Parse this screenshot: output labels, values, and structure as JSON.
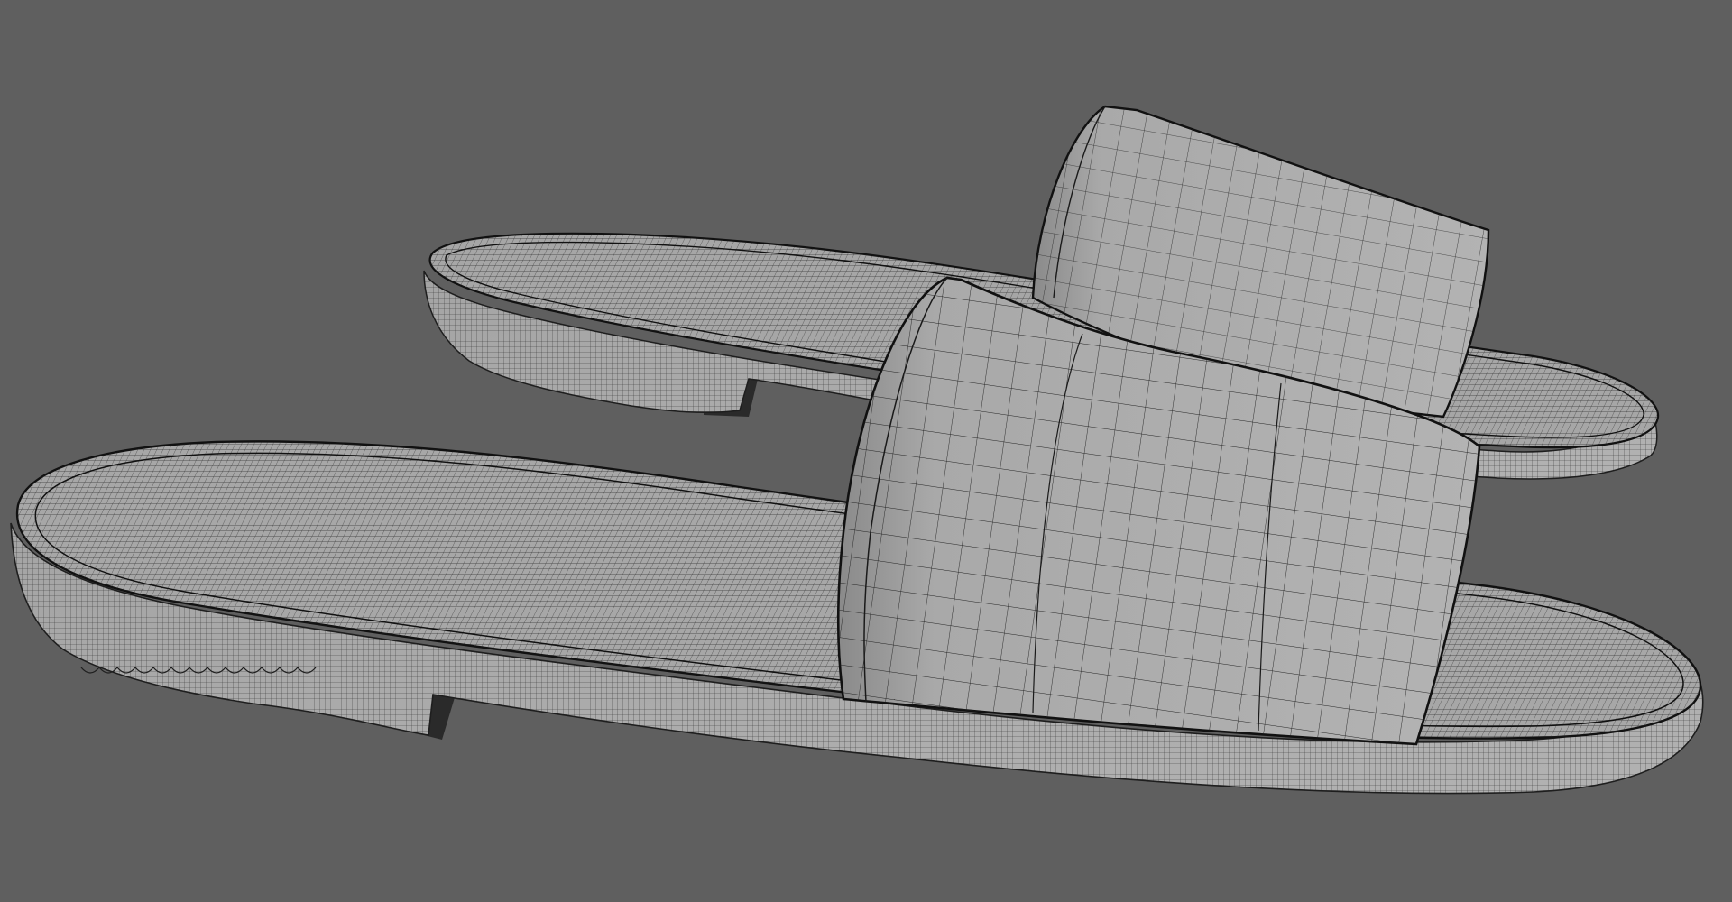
{
  "viewport": {
    "background_color": "#5f5f5f",
    "mesh_fill_color": "#a8a8a8",
    "mesh_shade_color": "#8c8c8c",
    "wire_color": "#1e1e1e",
    "shadow_color": "#2a2a2a"
  },
  "scene": {
    "objects": [
      {
        "name": "back-slide-sandal"
      },
      {
        "name": "front-slide-sandal"
      }
    ]
  }
}
